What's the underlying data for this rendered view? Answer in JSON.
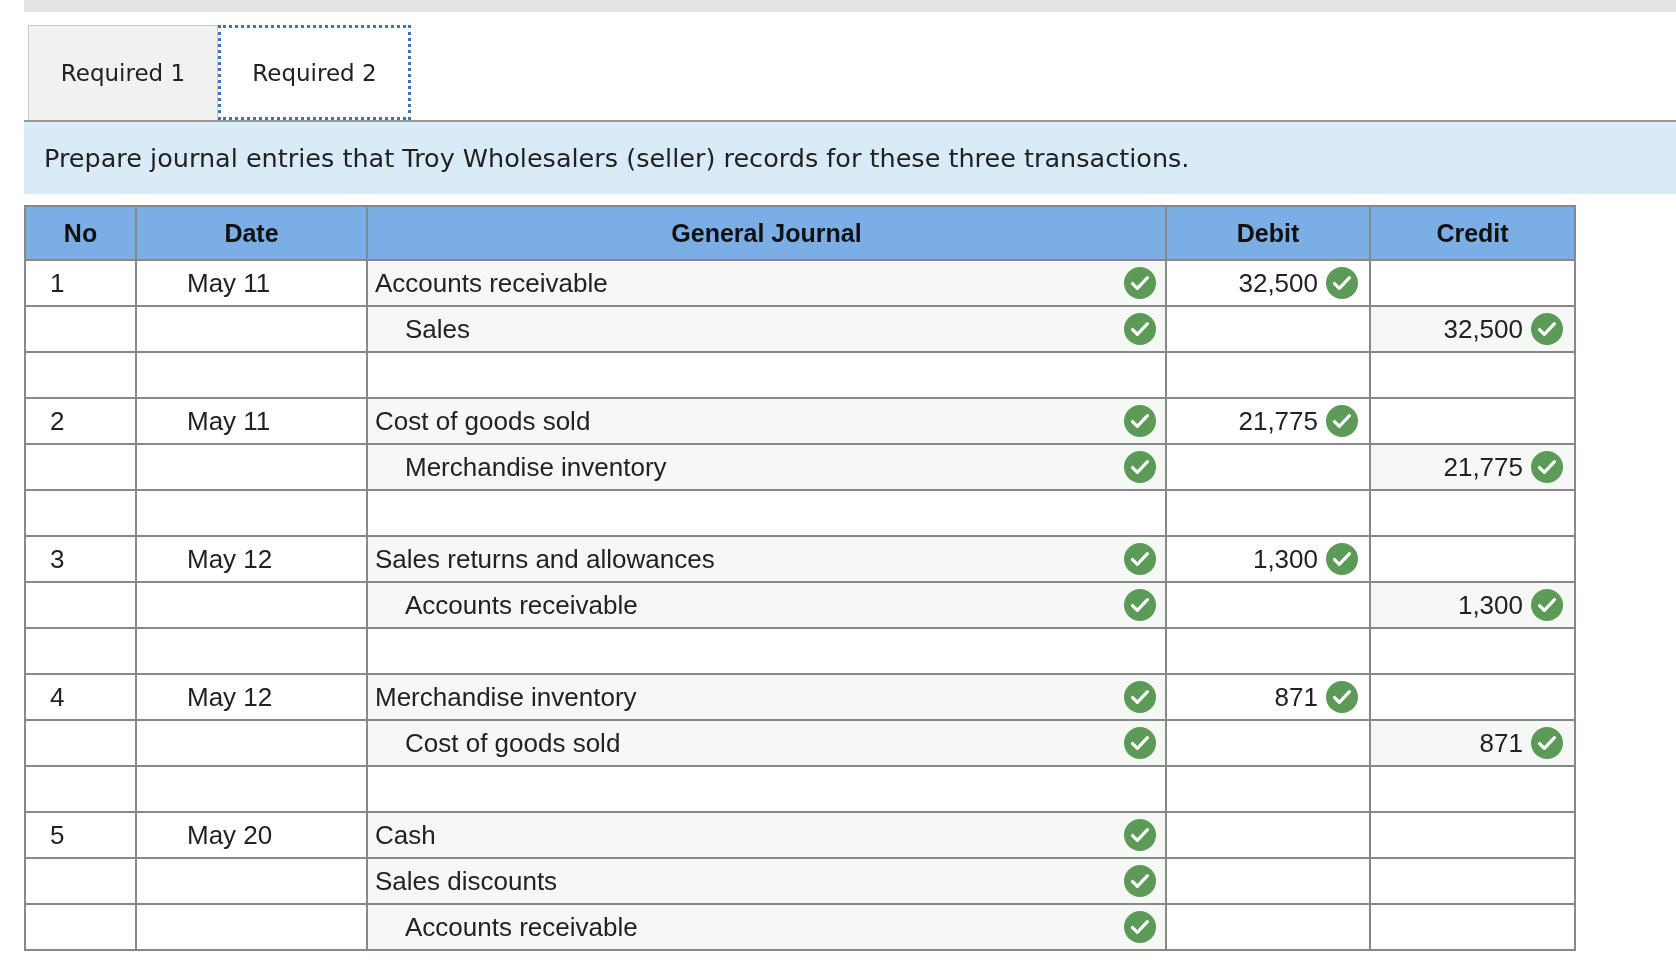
{
  "tabs": [
    {
      "label": "Required 1",
      "selected": false
    },
    {
      "label": "Required 2",
      "selected": true
    }
  ],
  "instruction": "Prepare journal entries that Troy Wholesalers (seller) records for these three transactions.",
  "table": {
    "columns": [
      "No",
      "Date",
      "General Journal",
      "Debit",
      "Credit"
    ],
    "rows": [
      {
        "kind": "entry",
        "no": "1",
        "date": "May 11",
        "account": "Accounts receivable",
        "indent": false,
        "account_check": true,
        "debit": "32,500",
        "debit_check": true
      },
      {
        "kind": "entry",
        "no": "",
        "date": "",
        "account": "Sales",
        "indent": true,
        "account_check": true,
        "credit": "32,500",
        "credit_check": true
      },
      {
        "kind": "blank"
      },
      {
        "kind": "entry",
        "no": "2",
        "date": "May 11",
        "account": "Cost of goods sold",
        "indent": false,
        "account_check": true,
        "debit": "21,775",
        "debit_check": true
      },
      {
        "kind": "entry",
        "no": "",
        "date": "",
        "account": "Merchandise inventory",
        "indent": true,
        "account_check": true,
        "credit": "21,775",
        "credit_check": true
      },
      {
        "kind": "blank"
      },
      {
        "kind": "entry",
        "no": "3",
        "date": "May 12",
        "account": "Sales returns and allowances",
        "indent": false,
        "account_check": true,
        "debit": "1,300",
        "debit_check": true
      },
      {
        "kind": "entry",
        "no": "",
        "date": "",
        "account": "Accounts receivable",
        "indent": true,
        "account_check": true,
        "credit": "1,300",
        "credit_check": true
      },
      {
        "kind": "blank"
      },
      {
        "kind": "entry",
        "no": "4",
        "date": "May 12",
        "account": "Merchandise inventory",
        "indent": false,
        "account_check": true,
        "debit": "871",
        "debit_check": true
      },
      {
        "kind": "entry",
        "no": "",
        "date": "",
        "account": "Cost of goods sold",
        "indent": true,
        "account_check": true,
        "credit": "871",
        "credit_check": true
      },
      {
        "kind": "blank"
      },
      {
        "kind": "entry",
        "no": "5",
        "date": "May 20",
        "account": "Cash",
        "indent": false,
        "account_check": true
      },
      {
        "kind": "entry",
        "no": "",
        "date": "",
        "account": "Sales discounts",
        "indent": false,
        "account_check": true
      },
      {
        "kind": "entry",
        "no": "",
        "date": "",
        "account": "Accounts receivable",
        "indent": true,
        "account_check": true
      }
    ]
  }
}
